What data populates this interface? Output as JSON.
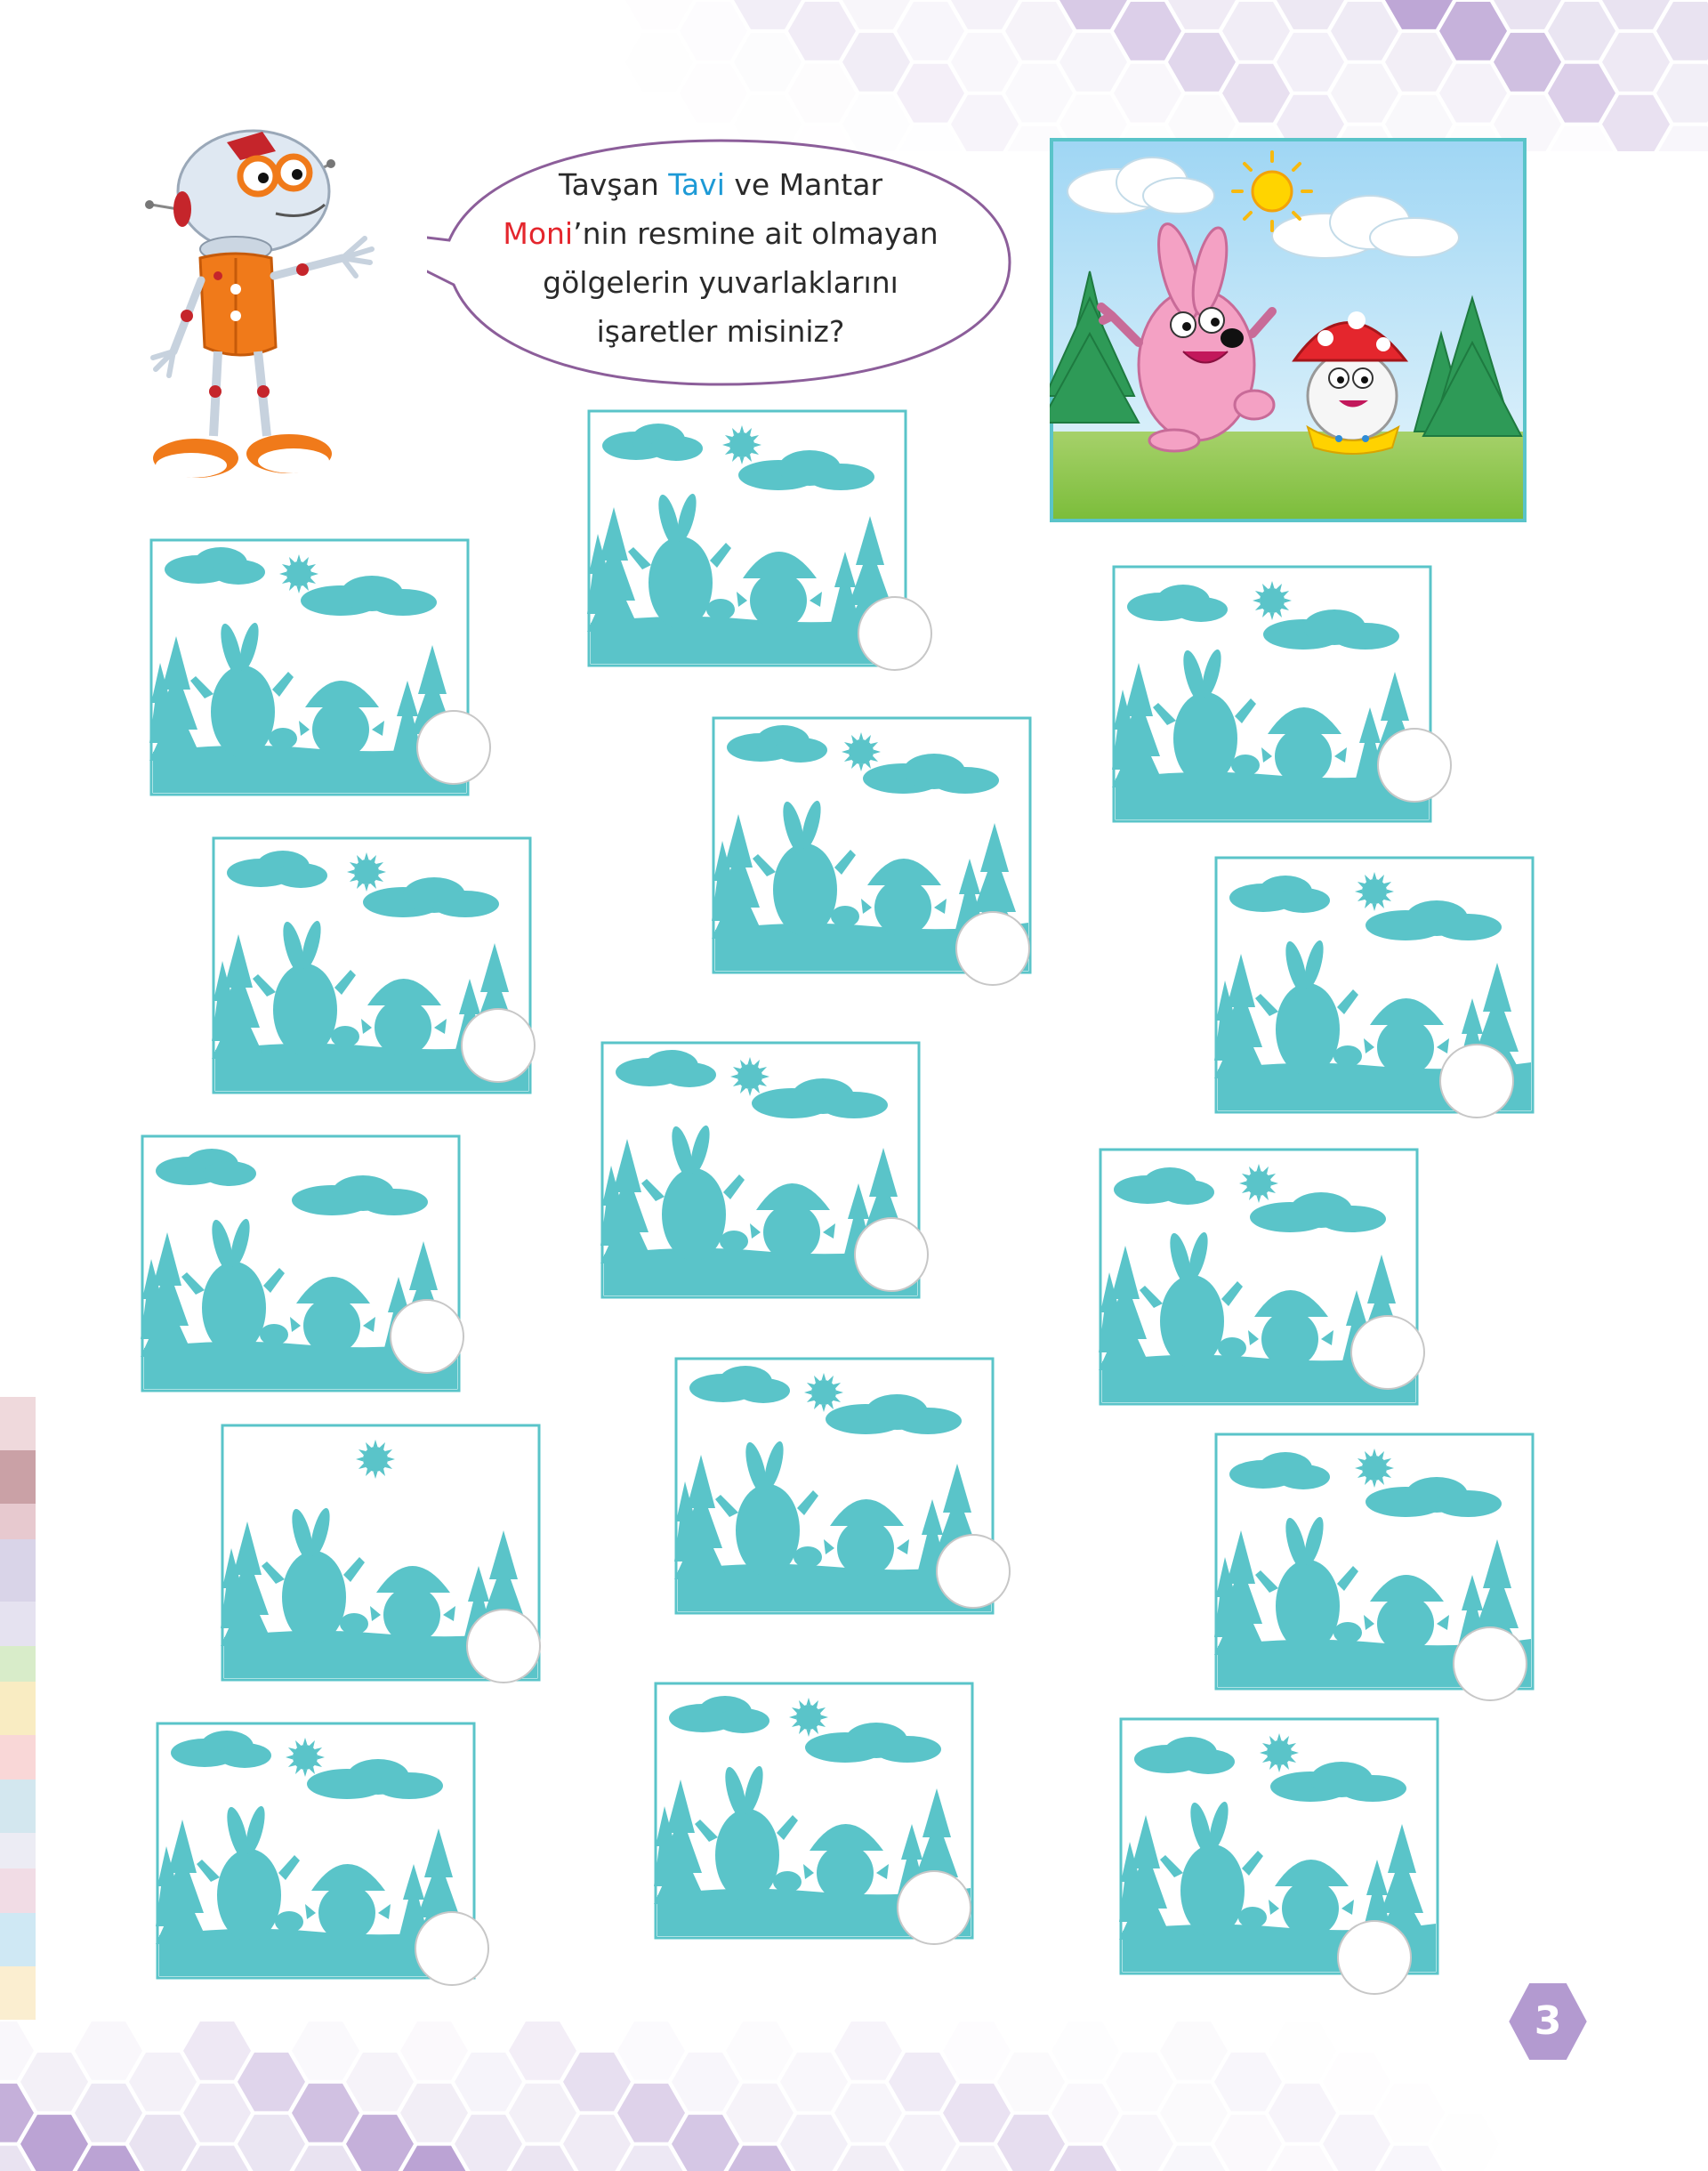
{
  "instruction": {
    "line1_pre": "Tavşan ",
    "line1_blue": "Tavi",
    "line1_post": " ve Mantar",
    "line2_red": "Moni",
    "line2_post": "’nin resmine ait olmayan",
    "line3": "gölgelerin yuvarlaklarını",
    "line4": "işaretler misiniz?"
  },
  "colors": {
    "shadow": "#5ac4c9",
    "hex_light": "#e9e3f1",
    "hex_dark": "#bba3d4",
    "bubble_border": "#8c5e9a",
    "tavi_blue": "#1d9ad6",
    "moni_red": "#e4262d"
  },
  "page_number": "3",
  "shadow_options": [
    {
      "id": 1,
      "sun": true,
      "clouds": true
    },
    {
      "id": 2,
      "sun": true,
      "clouds": true
    },
    {
      "id": 3,
      "sun": true,
      "clouds": true
    },
    {
      "id": 4,
      "sun": true,
      "clouds": true
    },
    {
      "id": 5,
      "sun": true,
      "clouds": true
    },
    {
      "id": 6,
      "sun": true,
      "clouds": true
    },
    {
      "id": 7,
      "sun": true,
      "clouds": true
    },
    {
      "id": 8,
      "sun": false,
      "clouds": true
    },
    {
      "id": 9,
      "sun": true,
      "clouds": true
    },
    {
      "id": 10,
      "sun": true,
      "clouds": true
    },
    {
      "id": 11,
      "sun": true,
      "clouds": false
    },
    {
      "id": 12,
      "sun": true,
      "clouds": true
    },
    {
      "id": 13,
      "sun": true,
      "clouds": true
    },
    {
      "id": 14,
      "sun": true,
      "clouds": true
    },
    {
      "id": 15,
      "sun": true,
      "clouds": true
    },
    {
      "id": 16,
      "sun": true,
      "clouds": true
    }
  ]
}
